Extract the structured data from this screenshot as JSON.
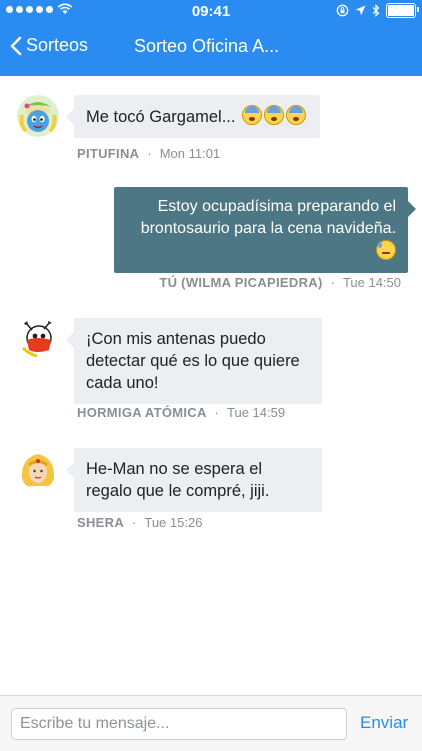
{
  "status": {
    "time": "09:41"
  },
  "nav": {
    "back_label": "Sorteos",
    "title": "Sorteo Oficina A..."
  },
  "messages": [
    {
      "text": "Me tocó Gargamel...",
      "author": "PITUFINA",
      "time": "Mon 11:01",
      "emoji": "fearful-face"
    },
    {
      "text": "Estoy ocupadísima preparando el brontosaurio para la cena navideña.",
      "author": "TÚ (WILMA PICAPIEDRA)",
      "time": "Tue 14:50",
      "emoji": "sweat-face"
    },
    {
      "text": "¡Con mis antenas puedo detectar qué es lo que quiere cada uno!",
      "author": "HORMIGA ATÓMICA",
      "time": "Tue 14:59"
    },
    {
      "text": "He-Man no se espera el regalo que le compré, jiji.",
      "author": "SHERA",
      "time": "Tue 15:26"
    }
  ],
  "composer": {
    "placeholder": "Escribe tu mensaje...",
    "send_label": "Enviar"
  },
  "colors": {
    "accent": "#2a8cf0",
    "outgoing_bubble": "#4d7785",
    "incoming_bubble": "#eceef1"
  },
  "separator": "·"
}
